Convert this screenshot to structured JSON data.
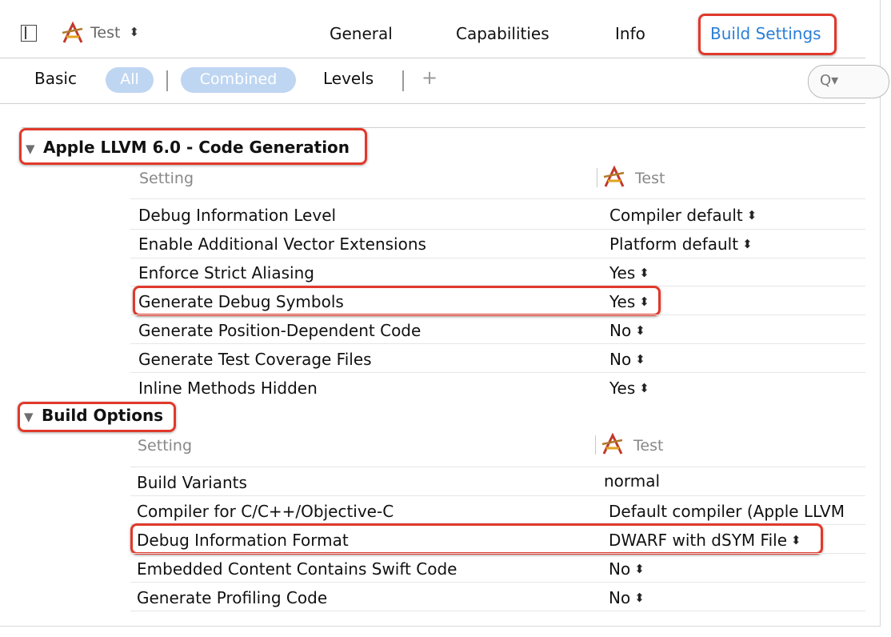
{
  "colors": {
    "highlight_border": "#e0392b",
    "tab_selected": "#2a7fd6",
    "pill_bg": "#bfd6f2"
  },
  "topbar": {
    "target": {
      "label": "Test",
      "stepper": "⬍"
    },
    "tabs": [
      {
        "label": "General"
      },
      {
        "label": "Capabilities"
      },
      {
        "label": "Info"
      },
      {
        "label": "Build Settings",
        "selected": true
      }
    ]
  },
  "filterbar": {
    "basic": "Basic",
    "all": "All",
    "combined": "Combined",
    "levels": "Levels",
    "add": "+",
    "search_icon": "Q▾"
  },
  "sections": [
    {
      "title": "Apple LLVM 6.0 - Code Generation",
      "header_setting": "Setting",
      "header_target": "Test",
      "rows": [
        {
          "name": "Debug Information Level",
          "value": "Compiler default",
          "stepper": "⬍"
        },
        {
          "name": "Enable Additional Vector Extensions",
          "value": "Platform default",
          "stepper": "⬍"
        },
        {
          "name": "Enforce Strict Aliasing",
          "value": "Yes",
          "stepper": "⬍"
        },
        {
          "name": "Generate Debug Symbols",
          "value": "Yes",
          "stepper": "⬍"
        },
        {
          "name": "Generate Position-Dependent Code",
          "value": "No",
          "stepper": "⬍"
        },
        {
          "name": "Generate Test Coverage Files",
          "value": "No",
          "stepper": "⬍"
        },
        {
          "name": "Inline Methods Hidden",
          "value": "Yes",
          "stepper": "⬍"
        }
      ]
    },
    {
      "title": "Build Options",
      "header_setting": "Setting",
      "header_target": "Test",
      "rows": [
        {
          "name": "Build Variants",
          "value": "normal",
          "stepper": ""
        },
        {
          "name": "Compiler for C/C++/Objective-C",
          "value": "Default compiler (Apple LLVM",
          "stepper": ""
        },
        {
          "name": "Debug Information Format",
          "value": "DWARF with dSYM File",
          "stepper": "⬍"
        },
        {
          "name": "Embedded Content Contains Swift Code",
          "value": "No",
          "stepper": "⬍"
        },
        {
          "name": "Generate Profiling Code",
          "value": "No",
          "stepper": "⬍"
        }
      ]
    }
  ]
}
